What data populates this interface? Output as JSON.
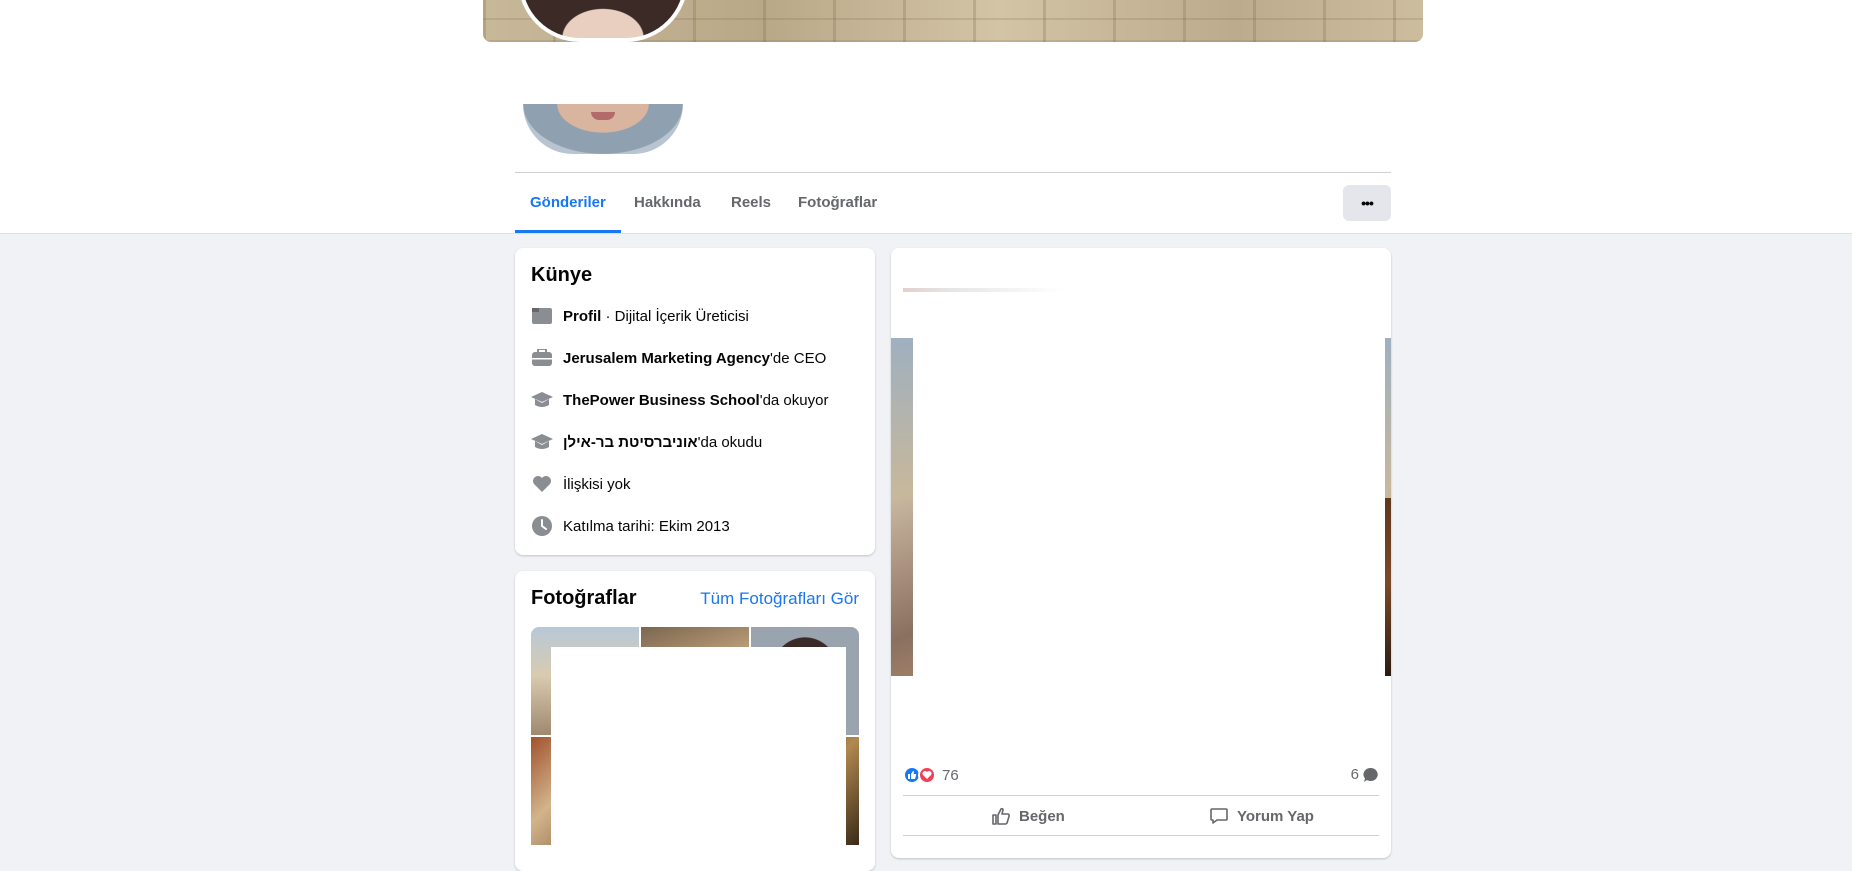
{
  "nav": {
    "tabs": [
      {
        "label": "Gönderiler",
        "active": true
      },
      {
        "label": "Hakkında"
      },
      {
        "label": "Reels"
      },
      {
        "label": "Fotoğraflar"
      }
    ],
    "more_label": "•••"
  },
  "intro": {
    "title": "Künye",
    "items": [
      {
        "icon": "page-flag-icon",
        "bold": "Profil",
        "text": " · Dijital İçerik Üreticisi"
      },
      {
        "icon": "briefcase-icon",
        "bold": "Jerusalem Marketing Agency",
        "text": "'de CEO"
      },
      {
        "icon": "graduation-cap-icon",
        "bold": "ThePower Business School",
        "text": "'da okuyor"
      },
      {
        "icon": "graduation-cap-icon",
        "bold": "אוניברסיטת בר-אילן",
        "text": "'da okudu"
      },
      {
        "icon": "heart-icon",
        "bold": "",
        "text": "İlişkisi yok"
      },
      {
        "icon": "clock-icon",
        "bold": "",
        "text": "Katılma tarihi: Ekim 2013"
      }
    ]
  },
  "photos": {
    "title": "Fotoğraflar",
    "see_all": "Tüm Fotoğrafları Gör"
  },
  "post": {
    "reaction_count": "76",
    "comment_count": "6",
    "like_label": "Beğen",
    "comment_label": "Yorum Yap"
  },
  "colors": {
    "accent": "#1877f2",
    "background": "#f0f2f5",
    "secondary_text": "#65676b",
    "love_red": "#f33e58"
  }
}
